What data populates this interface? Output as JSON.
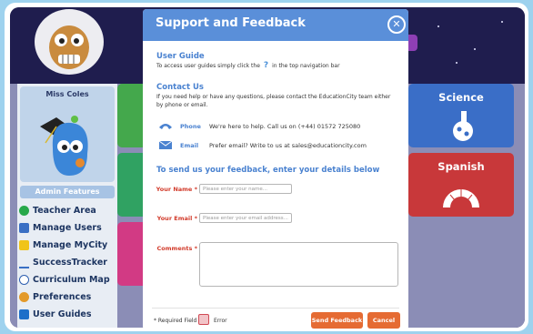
{
  "sidebar": {
    "user_name": "Miss Coles",
    "admin_heading": "Admin Features",
    "items": [
      {
        "label": "Teacher Area",
        "icon": "apple-icon",
        "color": "#27a84a"
      },
      {
        "label": "Manage Users",
        "icon": "users-icon",
        "color": "#3a6fc4"
      },
      {
        "label": "Manage MyCity",
        "icon": "city-icon",
        "color": "#f0c419"
      },
      {
        "label": "SuccessTracker",
        "icon": "tracker-icon",
        "color": "#3a6fc4"
      },
      {
        "label": "Curriculum Map",
        "icon": "curriculum-icon",
        "color": "#2e5fb0"
      },
      {
        "label": "Preferences",
        "icon": "preferences-icon",
        "color": "#e39a2b"
      },
      {
        "label": "User Guides",
        "icon": "user-guides-icon",
        "color": "#1d6fc9"
      }
    ]
  },
  "tiles": {
    "science": "Science",
    "spanish": "Spanish",
    "colors": {
      "science": "#3a6ec7",
      "spanish": "#c8383a",
      "green1": "#44a84c",
      "green2": "#30a262",
      "pink": "#d23a84"
    }
  },
  "modal": {
    "title": "Support and Feedback",
    "close_symbol": "✕",
    "user_guide": {
      "title": "User Guide",
      "text_before": "To access user guides simply click the",
      "icon_symbol": "?",
      "text_after": "in the top navigation bar"
    },
    "contact": {
      "title": "Contact Us",
      "text": "If you need help or have any questions, please contact the EducationCity team either by phone or email.",
      "phone_label": "Phone",
      "phone_text": "We're here to help. Call us on (+44) 01572 725080",
      "email_label": "Email",
      "email_text": "Prefer email? Write to us at sales@educationcity.com"
    },
    "feedback": {
      "title": "To send us your feedback, enter your details below",
      "name_label": "Your Name *",
      "name_placeholder": "Please enter your name...",
      "email_label": "Your Email *",
      "email_placeholder": "Please enter your email address...",
      "comments_label": "Comments *"
    },
    "footer": {
      "required_note": "* Required Field",
      "error_label": "Error",
      "send_label": "Send Feedback",
      "cancel_label": "Cancel"
    },
    "colors": {
      "header": "#5a8fd9",
      "accent_text": "#4a82d0",
      "required": "#d23c2c",
      "button": "#e56b33"
    }
  }
}
